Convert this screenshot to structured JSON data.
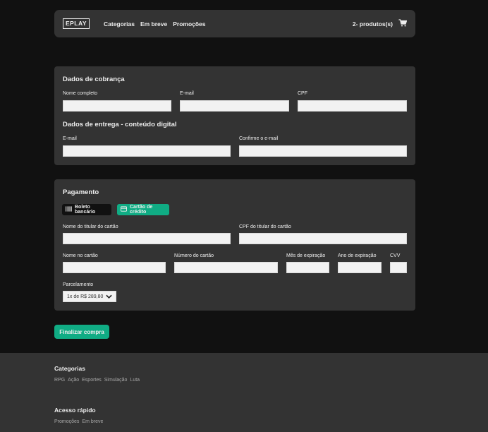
{
  "header": {
    "logo": "EPLAY",
    "nav": [
      "Categorias",
      "Em breve",
      "Promoções"
    ],
    "cart_label": "2- produtos(s)"
  },
  "billing": {
    "title": "Dados de cobrança",
    "fields": {
      "full_name": {
        "label": "Nome completo",
        "value": ""
      },
      "email": {
        "label": "E-mail",
        "value": ""
      },
      "cpf": {
        "label": "CPF",
        "value": ""
      }
    },
    "delivery_title": "Dados de entrega - conteúdo digital",
    "delivery_fields": {
      "email": {
        "label": "E-mail",
        "value": ""
      },
      "confirm_email": {
        "label": "Confirme o e-mail",
        "value": ""
      }
    }
  },
  "payment": {
    "title": "Pagamento",
    "methods": {
      "boleto": {
        "label": "Boleto bancário",
        "icon": "barcode-icon",
        "selected": false
      },
      "credit": {
        "label": "Cartão de crédito",
        "icon": "credit-card-icon",
        "selected": true
      }
    },
    "fields": {
      "cardholder_name": {
        "label": "Nome do titular do cartão",
        "value": ""
      },
      "cardholder_cpf": {
        "label": "CPF do titular do cartão",
        "value": ""
      },
      "card_name": {
        "label": "Nome no cartão",
        "value": ""
      },
      "card_number": {
        "label": "Número do cartão",
        "value": ""
      },
      "exp_month": {
        "label": "Mês de expiração",
        "value": ""
      },
      "exp_year": {
        "label": "Ano de expiração",
        "value": ""
      },
      "cvv": {
        "label": "CVV",
        "value": ""
      }
    },
    "installments": {
      "label": "Parcelamento",
      "selected": "1x de R$ 289,80"
    }
  },
  "finish_button": "Finalizar compra",
  "footer": {
    "sections": [
      {
        "title": "Categorias",
        "links": [
          "RPG",
          "Ação",
          "Esportes",
          "Simulação",
          "Luta"
        ]
      },
      {
        "title": "Acesso rápido",
        "links": [
          "Promoções",
          "Em breve"
        ]
      }
    ]
  },
  "colors": {
    "background": "#111111",
    "card": "#333333",
    "accent": "#10ac84",
    "input": "#f2f2f2"
  }
}
